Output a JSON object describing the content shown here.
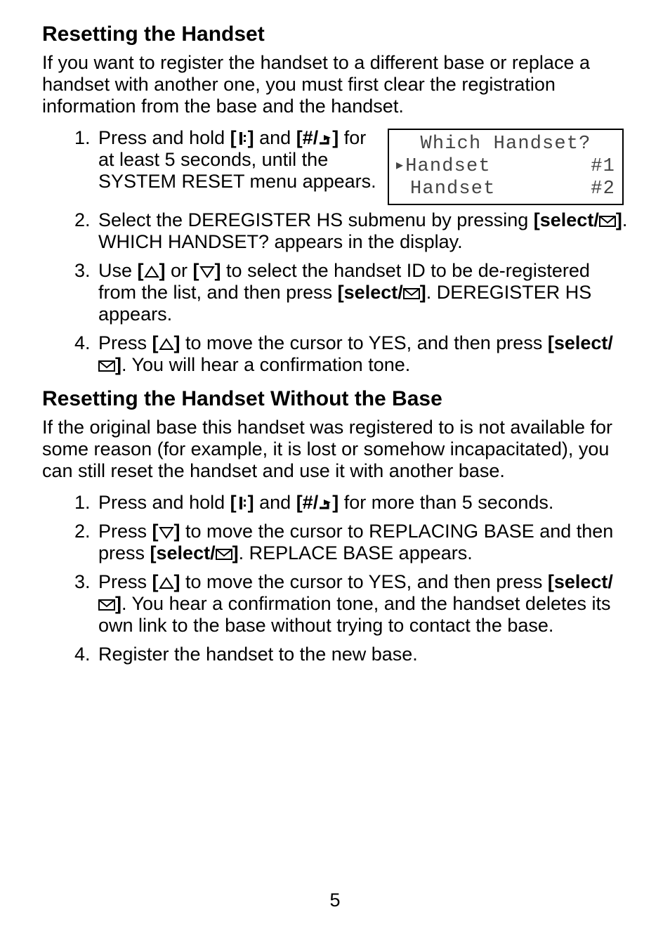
{
  "section1": {
    "heading": "Resetting the Handset",
    "intro": "If you want to register the handset to a different base or replace a handset with another one, you must first clear the registration information from the base and the handset.",
    "steps": {
      "s1a": "Press and hold ",
      "s1b": " and ",
      "s1c": " for at least 5 seconds, until the SYSTEM RESET menu appears.",
      "s2a": "Select the DEREGISTER HS submenu by pressing ",
      "s2b": ". WHICH HANDSET? appears in the display.",
      "s3a": "Use ",
      "s3b": " or ",
      "s3c": " to select the handset ID to be de-registered from the list, and then press ",
      "s3d": ". DEREGISTER HS appears.",
      "s4a": "Press ",
      "s4b": " to move the cursor to YES, and then press ",
      "s4c": ". You will hear a confirmation tone."
    }
  },
  "lcd": {
    "line1": "Which Handset?",
    "line2a": "Handset",
    "line2b": "#1",
    "line3a": "Handset",
    "line3b": "#2"
  },
  "section2": {
    "heading": "Resetting the Handset Without the Base",
    "intro": "If the original base this handset was registered to is not available for some reason (for example, it is lost or somehow incapacitated), you can still reset the handset and use it with another base.",
    "steps": {
      "s1a": "Press and hold ",
      "s1b": " and ",
      "s1c": " for more than 5 seconds.",
      "s2a": "Press ",
      "s2b": " to move the cursor to REPLACING BASE and then press ",
      "s2c": ". REPLACE BASE appears.",
      "s3a": "Press ",
      "s3b": " to move the cursor to YES, and then press ",
      "s3c": ". You hear a confirmation tone, and the handset deletes its own link to the base without trying to contact the base.",
      "s4": "Register the handset to the new base."
    }
  },
  "keys": {
    "end": "[",
    "endClose": "]",
    "hash": "[#/",
    "hashClose": "]",
    "select": "[select/",
    "selectClose": "]",
    "open": "[",
    "close": "]"
  },
  "footer": "5"
}
